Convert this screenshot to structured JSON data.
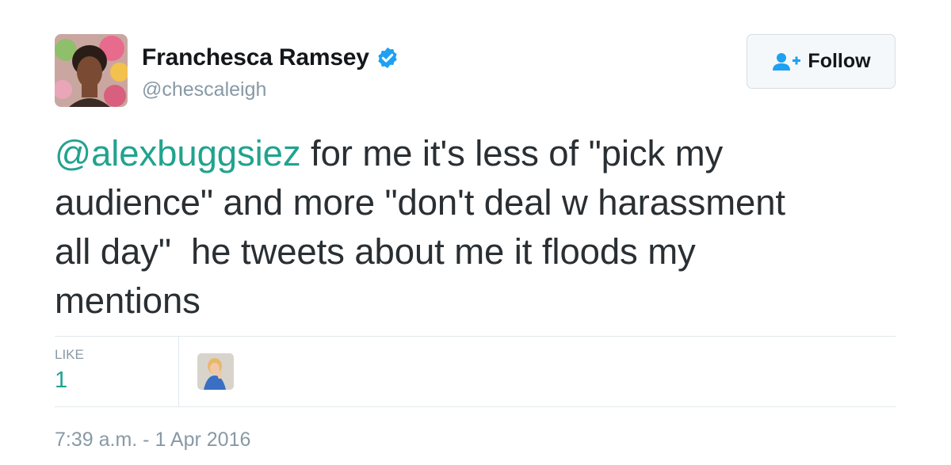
{
  "author": {
    "display_name": "Franchesca Ramsey",
    "handle": "@chescaleigh",
    "verified": true,
    "avatar_icon": "profile-photo"
  },
  "follow_button": {
    "label": "Follow",
    "icon": "follow-user-icon"
  },
  "tweet": {
    "mention": "@alexbuggsiez",
    "text_line1_rest": " for me it's less of \"pick my",
    "text_line2": "audience\" and more \"don't deal w harassment",
    "text_line3": "all day\"  he tweets about me it floods my",
    "text_line4": "mentions"
  },
  "stats": {
    "like_label": "LIKE",
    "like_count": "1"
  },
  "timestamp": "7:39 a.m. - 1 Apr 2016",
  "colors": {
    "mention": "#21a38f",
    "verified_badge": "#1da1f2",
    "secondary_text": "#8899a6",
    "follow_icon": "#1da1f2"
  }
}
